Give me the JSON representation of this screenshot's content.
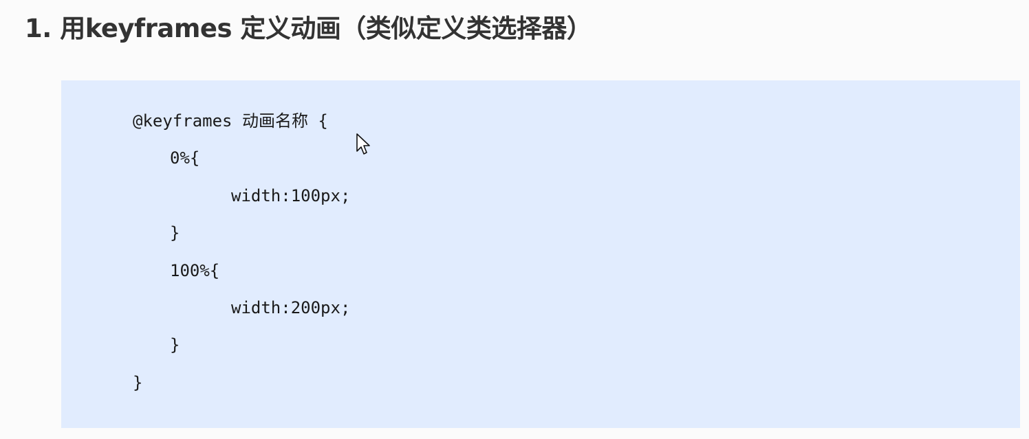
{
  "heading": {
    "number": "1.",
    "text": "用keyframes 定义动画（类似定义类选择器）"
  },
  "code": {
    "lines": [
      "@keyframes 动画名称 {",
      "0%{",
      "width:100px;",
      "}",
      "100%{",
      "width:200px;",
      "}",
      "}"
    ]
  },
  "colors": {
    "code_background": "#e1ecfe",
    "page_background": "#fbfbfb",
    "heading_text": "#333333"
  },
  "icons": {
    "cursor": "mouse-pointer-icon"
  }
}
